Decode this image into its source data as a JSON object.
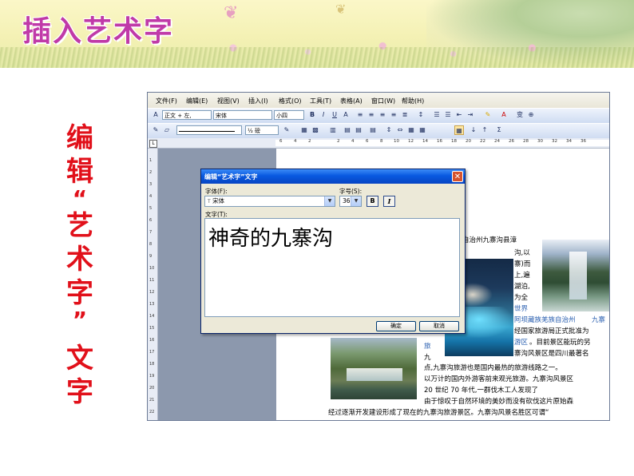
{
  "slide": {
    "title": "插入艺术字",
    "vertical_caption": [
      "编",
      "辑",
      "“",
      "艺",
      "术",
      "字",
      "”",
      "文",
      "字"
    ]
  },
  "word": {
    "menu": [
      "文件(F)",
      "编辑(E)",
      "视图(V)",
      "插入(I)",
      "格式(O)",
      "工具(T)",
      "表格(A)",
      "窗口(W)",
      "帮助(H)"
    ],
    "toolbar1": {
      "style": "正文 + 左,",
      "font": "宋体",
      "size": "小四"
    },
    "toolbar2": {
      "line_weight": "½ 磅"
    },
    "ruler_numbers": [
      "6",
      "4",
      "2",
      "2",
      "4",
      "6",
      "8",
      "10",
      "12",
      "14",
      "16",
      "18",
      "20",
      "22",
      "24",
      "26",
      "28",
      "30",
      "32",
      "34",
      "36"
    ],
    "vruler_numbers": [
      "1",
      "2",
      "3",
      "4",
      "5",
      "6",
      "7",
      "8",
      "9",
      "10",
      "11",
      "12",
      "13",
      "14",
      "15",
      "16",
      "17",
      "18",
      "19",
      "20",
      "21",
      "22"
    ],
    "doc_lines": [
      "自治州九寨沟县漳",
      "沟,以",
      "寨)而",
      "上,遍",
      "湖泊,",
      "为全"
    ],
    "doc_blue": [
      "世界",
      "阿坝藏族羌族自治州",
      "九寨",
      "旅",
      "游区",
      "九"
    ],
    "doc_tail": [
      "经国家旅游局正式批准为",
      "。目前景区能玩的另",
      "寨沟风景区是四川最著名",
      "点,九寨沟旅游也是国内最热的旅游线路之一。",
      "以万计的国内外游客前来观光旅游。九寨沟风景区",
      "20 世纪 70 年代,一群伐木工人发现了",
      "由于惊叹于自然环境的美妙而没有砍伐这片原始森",
      "经过逐渐开发建设形成了现在的九寨沟旅游景区。九寨沟风景名胜区可谓“"
    ]
  },
  "dialog": {
    "title": "编辑“艺术字”文字",
    "font_label": "字体(F):",
    "font_value": "宋体",
    "size_label": "字号(S):",
    "size_value": "36",
    "bold": "B",
    "italic": "I",
    "text_label": "文字(T):",
    "text_value": "神奇的九寨沟",
    "ok": "确定",
    "cancel": "取消"
  },
  "colors": {
    "title": "#c03aa8",
    "caption": "#e1101a",
    "dialog_caption": "#0859e0",
    "link_text": "#2a5fb0"
  }
}
